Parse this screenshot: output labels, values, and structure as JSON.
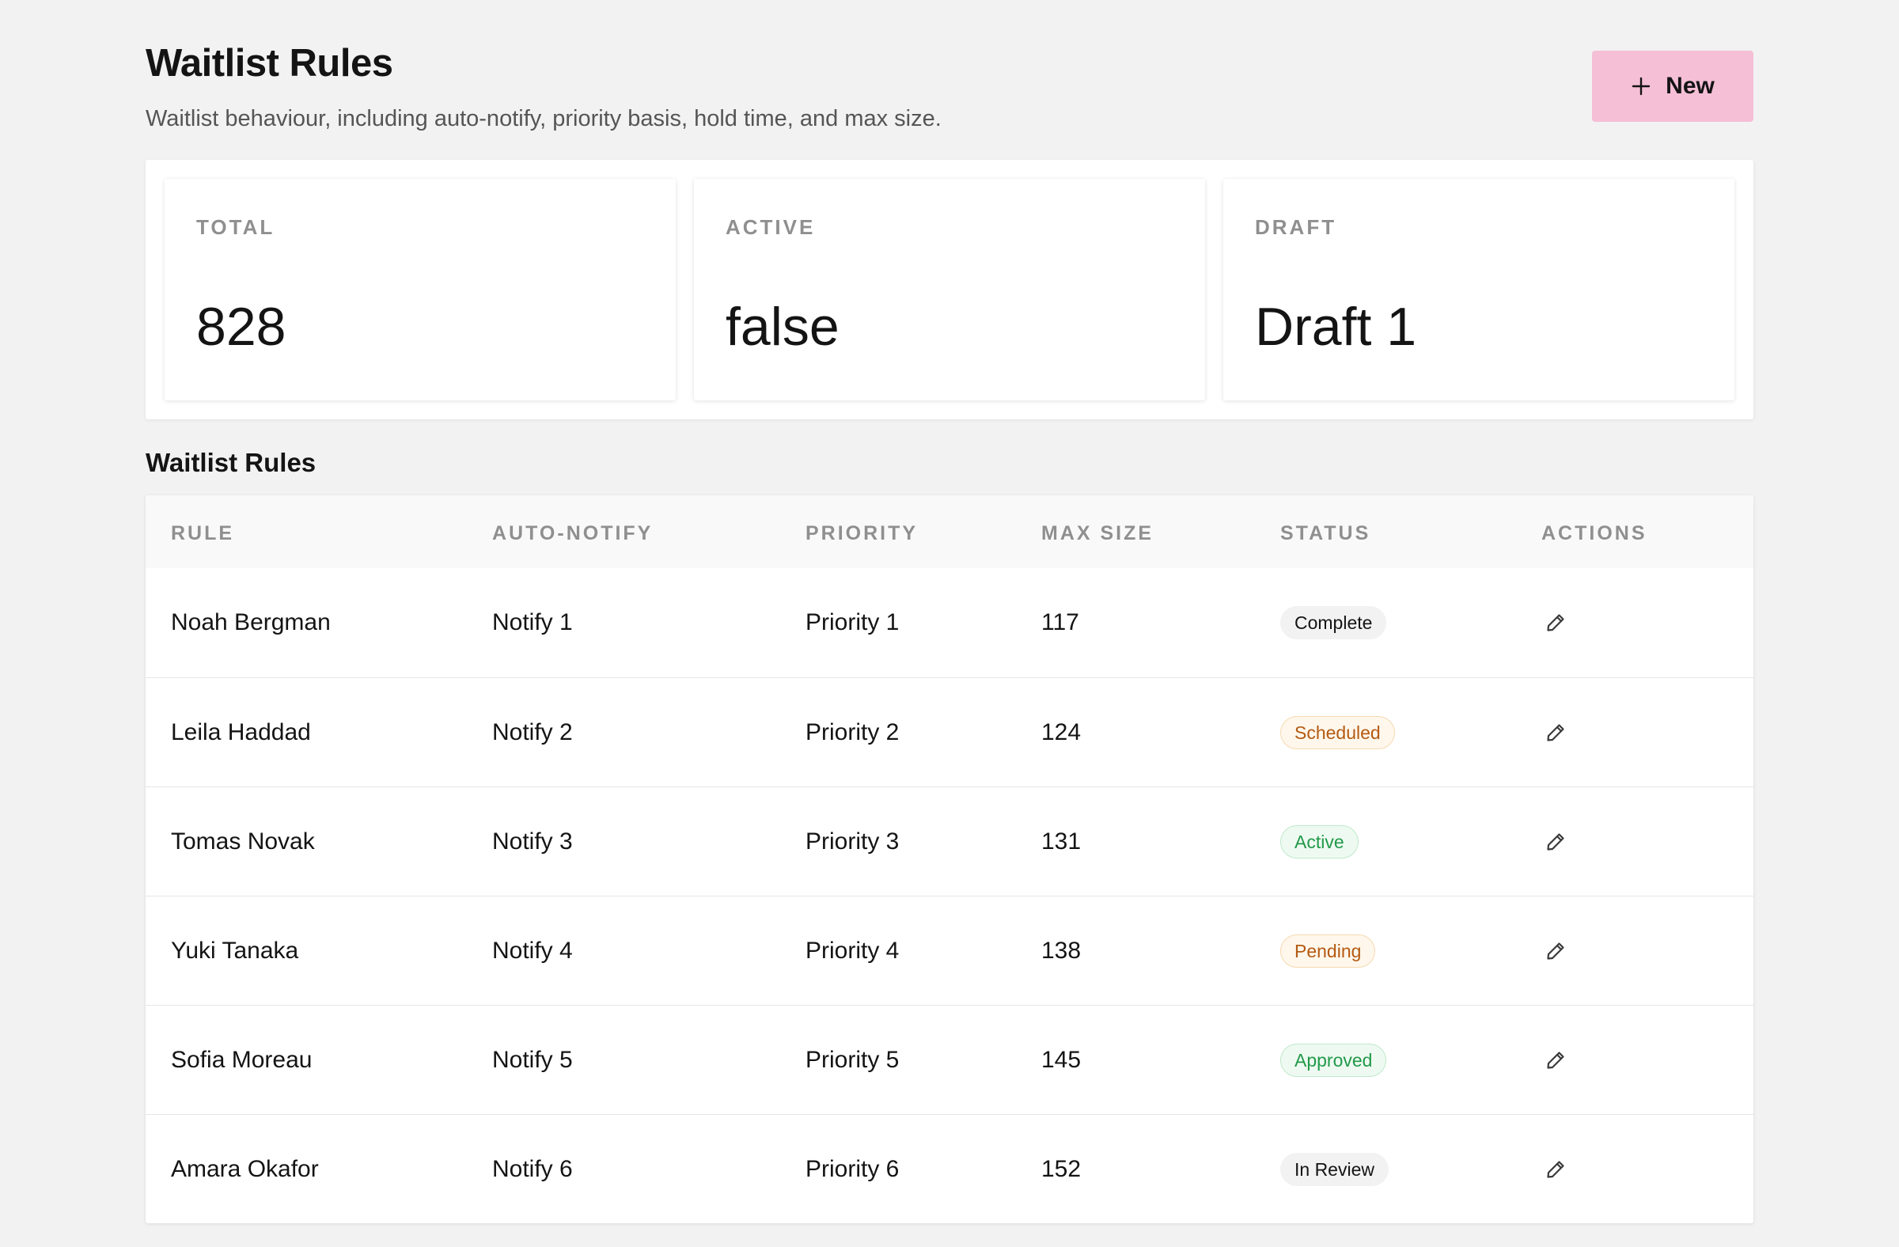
{
  "header": {
    "title": "Waitlist Rules",
    "subtitle": "Waitlist behaviour, including auto-notify, priority basis, hold time, and max size.",
    "new_button_label": "New"
  },
  "stats": [
    {
      "label": "TOTAL",
      "value": "828"
    },
    {
      "label": "ACTIVE",
      "value": "false"
    },
    {
      "label": "DRAFT",
      "value": "Draft 1"
    }
  ],
  "table": {
    "section_title": "Waitlist Rules",
    "columns": [
      "RULE",
      "AUTO-NOTIFY",
      "PRIORITY",
      "MAX SIZE",
      "STATUS",
      "ACTIONS"
    ],
    "rows": [
      {
        "rule": "Noah Bergman",
        "notify": "Notify 1",
        "priority": "Priority 1",
        "max_size": "117",
        "status": "Complete"
      },
      {
        "rule": "Leila Haddad",
        "notify": "Notify 2",
        "priority": "Priority 2",
        "max_size": "124",
        "status": "Scheduled"
      },
      {
        "rule": "Tomas Novak",
        "notify": "Notify 3",
        "priority": "Priority 3",
        "max_size": "131",
        "status": "Active"
      },
      {
        "rule": "Yuki Tanaka",
        "notify": "Notify 4",
        "priority": "Priority 4",
        "max_size": "138",
        "status": "Pending"
      },
      {
        "rule": "Sofia Moreau",
        "notify": "Notify 5",
        "priority": "Priority 5",
        "max_size": "145",
        "status": "Approved"
      },
      {
        "rule": "Amara Okafor",
        "notify": "Notify 6",
        "priority": "Priority 6",
        "max_size": "152",
        "status": "In Review"
      }
    ]
  },
  "status_styles": {
    "Complete": {
      "bg": "#f2f2f2",
      "fg": "#141414",
      "border": "#f2f2f2"
    },
    "Scheduled": {
      "bg": "#fff7ec",
      "fg": "#b45a12",
      "border": "#f6d9b0"
    },
    "Active": {
      "bg": "#eefaf1",
      "fg": "#22994a",
      "border": "#bfe8cb"
    },
    "Pending": {
      "bg": "#fff7ec",
      "fg": "#b45a12",
      "border": "#f6d9b0"
    },
    "Approved": {
      "bg": "#eefaf1",
      "fg": "#22994a",
      "border": "#bfe8cb"
    },
    "In Review": {
      "bg": "#f2f2f2",
      "fg": "#141414",
      "border": "#f2f2f2"
    }
  },
  "colors": {
    "page_bg": "#f2f2f2",
    "accent": "#f5bfd6",
    "text": "#141414",
    "muted": "#8f8f8f"
  },
  "icons": {
    "new_button": "plus-icon",
    "row_action": "pencil-icon"
  }
}
